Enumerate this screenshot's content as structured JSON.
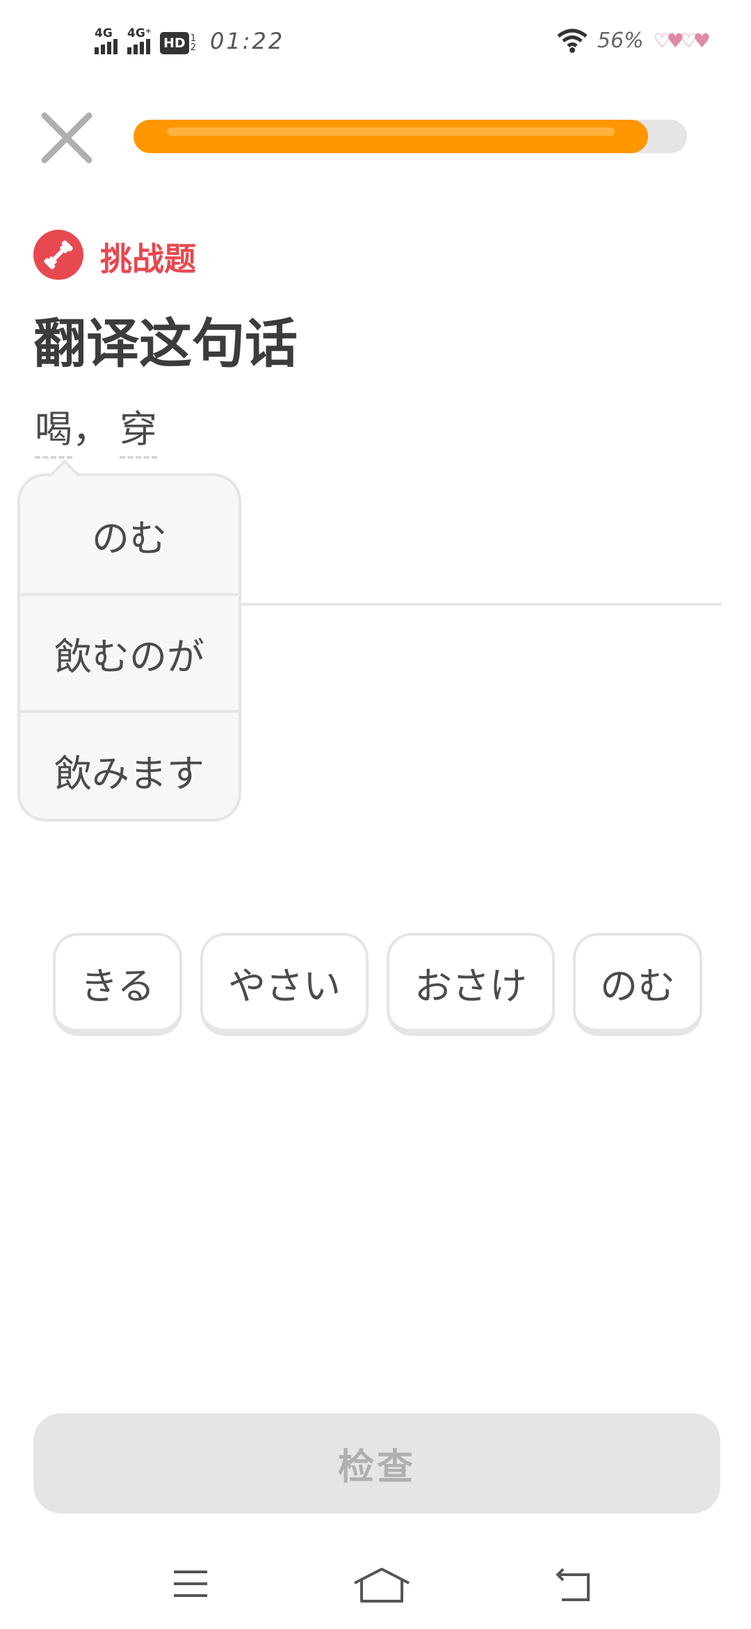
{
  "status_bar": {
    "network_1": "4G",
    "network_2": "4G⁺",
    "hd_label": "HD",
    "hd_sub_top": "1",
    "hd_sub_bottom": "2",
    "time": "01:22",
    "battery": "56%"
  },
  "progress": {
    "fraction": 0.93
  },
  "challenge": {
    "label": "挑战题",
    "icon": "dumbbell-icon",
    "accent_color": "#e8484f"
  },
  "title": "翻译这句话",
  "prompt": {
    "word_1": "喝",
    "separator": "，",
    "word_2": "穿"
  },
  "hint_popup": {
    "items": [
      "のむ",
      "飲むのが",
      "飲みます"
    ]
  },
  "word_bank": [
    "きる",
    "やさい",
    "おさけ",
    "のむ"
  ],
  "check_button": {
    "label": "检查"
  },
  "colors": {
    "progress": "#ff9600",
    "disabled": "#e5e5e5",
    "text": "#4b4b4b"
  }
}
